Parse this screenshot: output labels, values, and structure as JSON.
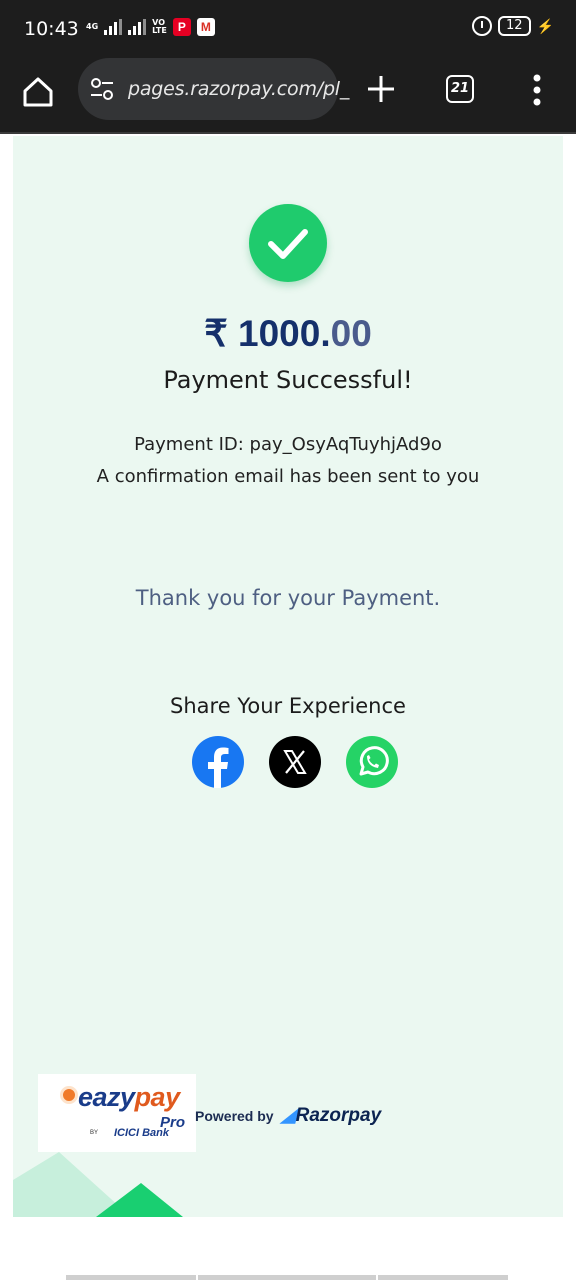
{
  "status_bar": {
    "time": "10:43",
    "network_tag": "4G",
    "volte_tag": "VO\nLTE",
    "battery": "12"
  },
  "browser": {
    "url": "pages.razorpay.com/pl_",
    "tab_count": "21"
  },
  "payment": {
    "currency_symbol": "₹",
    "amount_main": "1000.",
    "amount_paise": "00",
    "title": "Payment Successful!",
    "payment_id": "Payment ID: pay_OsyAqTuyhjAd9o",
    "confirmation": "A confirmation email has been sent to you",
    "thanks": "Thank you for your Payment."
  },
  "share": {
    "title": "Share Your Experience",
    "networks": [
      "facebook",
      "x",
      "whatsapp"
    ]
  },
  "footer": {
    "eazypay_prefix": "eazy",
    "eazypay_suffix": "pay",
    "eazypay_pro": "Pro",
    "eazypay_by": "BY",
    "bank_name": "ICICI Bank",
    "powered_by": "Powered by",
    "razorpay": "Razorpay"
  },
  "colors": {
    "success_green": "#1fcb6d",
    "page_bg": "#ebf8f1",
    "amount_navy": "#15306b",
    "facebook": "#1877f2",
    "whatsapp": "#25d366"
  }
}
